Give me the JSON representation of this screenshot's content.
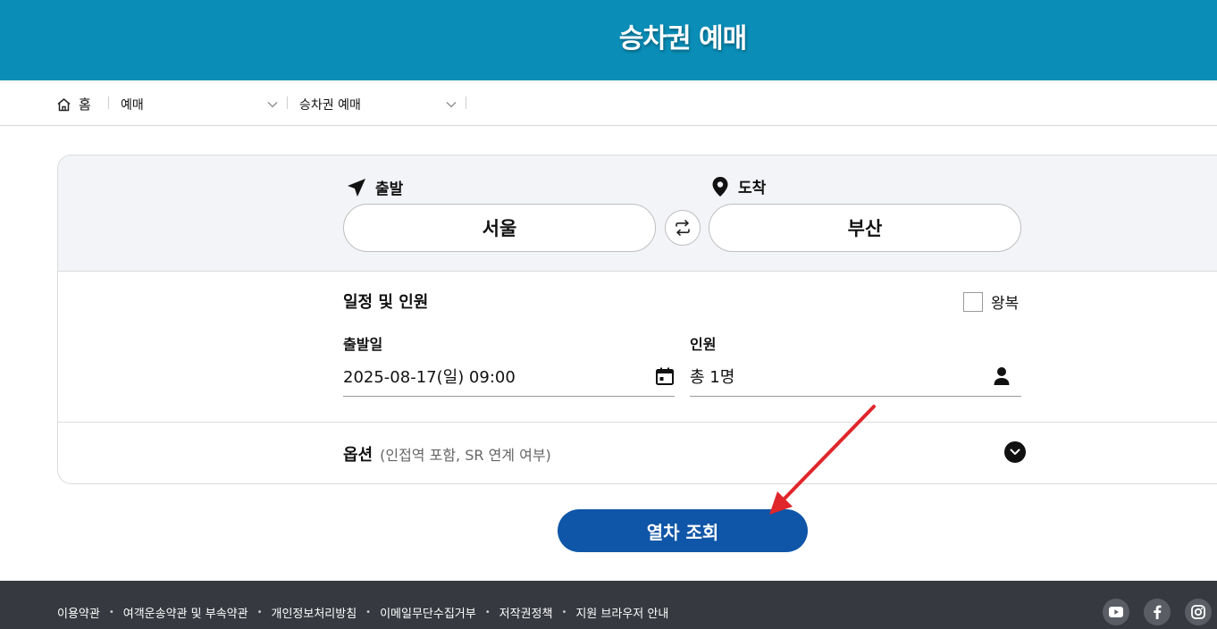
{
  "header": {
    "title": "승차권 예매"
  },
  "breadcrumb": {
    "home": "홈",
    "level1": "예매",
    "level2": "승차권 예매"
  },
  "route": {
    "departure_label": "출발",
    "arrival_label": "도착",
    "departure_station": "서울",
    "arrival_station": "부산"
  },
  "schedule": {
    "section_title": "일정 및 인원",
    "roundtrip_label": "왕복",
    "roundtrip_checked": false,
    "date_label": "출발일",
    "date_value": "2025-08-17(일) 09:00",
    "passengers_label": "인원",
    "passengers_value": "총 1명"
  },
  "options": {
    "title": "옵션",
    "subtitle": "(인접역 포함, SR 연계 여부)"
  },
  "search_button": "열차 조회",
  "footer": {
    "links": [
      "이용약관",
      "여객운송약관 및 부속약관",
      "개인정보처리방침",
      "이메일무단수집거부",
      "저작권정책",
      "지원 브라우저 안내"
    ],
    "social": [
      "youtube-icon",
      "facebook-icon",
      "instagram-icon"
    ]
  },
  "colors": {
    "header": "#0a8eb8",
    "primary_button": "#0f56a8",
    "footer": "#363a40",
    "annotation_arrow": "#e0262b"
  }
}
